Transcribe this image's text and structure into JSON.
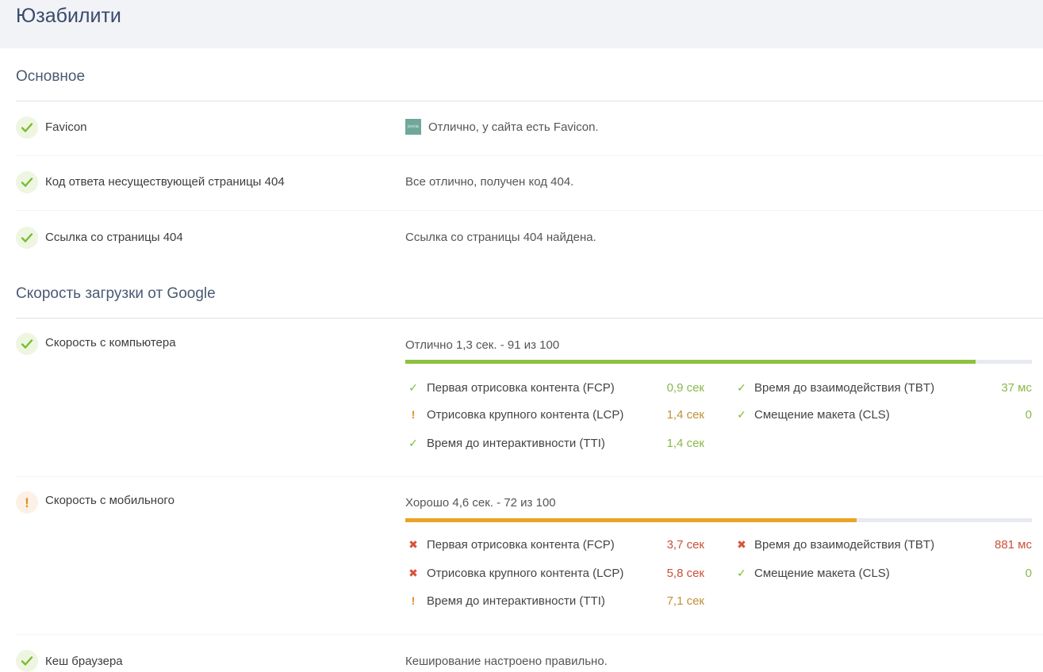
{
  "header": {
    "title": "Юзабилити"
  },
  "sections": {
    "basic": {
      "title": "Основное"
    },
    "speed": {
      "title": "Скорость загрузки от Google"
    }
  },
  "rows": {
    "favicon": {
      "label": "Favicon",
      "value": "Отлично, у сайта есть Favicon.",
      "status": "ok",
      "favicon_text": "Jomla"
    },
    "code404": {
      "label": "Код ответа несуществующей страницы 404",
      "value": "Все отлично, получен код 404.",
      "status": "ok"
    },
    "link404": {
      "label": "Ссылка со страницы 404",
      "value": "Ссылка со страницы 404 найдена.",
      "status": "ok"
    },
    "cache": {
      "label": "Кеш браузера",
      "value": "Кеширование настроено правильно.",
      "status": "ok"
    }
  },
  "desktop": {
    "label": "Скорость с компьютера",
    "summary": "Отлично 1,3 сек. - 91 из 100",
    "status": "ok",
    "score": 91,
    "bar_color": "#8dc040",
    "metrics": {
      "fcp": {
        "name": "Первая отрисовка контента (FCP)",
        "value": "0,9 сек",
        "status": "ok"
      },
      "lcp": {
        "name": "Отрисовка крупного контента (LCP)",
        "value": "1,4 сек",
        "status": "warn"
      },
      "tti": {
        "name": "Время до интерактивности (TTI)",
        "value": "1,4 сек",
        "status": "ok"
      },
      "tbt": {
        "name": "Время до взаимодействия (TBT)",
        "value": "37 мс",
        "status": "ok"
      },
      "cls": {
        "name": "Смещение макета (CLS)",
        "value": "0",
        "status": "ok"
      }
    }
  },
  "mobile": {
    "label": "Скорость с мобильного",
    "summary": "Хорошо 4,6 сек. - 72 из 100",
    "status": "warn",
    "score": 72,
    "bar_color": "#eba425",
    "metrics": {
      "fcp": {
        "name": "Первая отрисовка контента (FCP)",
        "value": "3,7 сек",
        "status": "bad"
      },
      "lcp": {
        "name": "Отрисовка крупного контента (LCP)",
        "value": "5,8 сек",
        "status": "bad"
      },
      "tti": {
        "name": "Время до интерактивности (TTI)",
        "value": "7,1 сек",
        "status": "warn"
      },
      "tbt": {
        "name": "Время до взаимодействия (TBT)",
        "value": "881 мс",
        "status": "bad"
      },
      "cls": {
        "name": "Смещение макета (CLS)",
        "value": "0",
        "status": "ok"
      }
    }
  },
  "colors": {
    "ok": "#7cbb35",
    "warn": "#e48b2c",
    "bad": "#d8523a"
  }
}
